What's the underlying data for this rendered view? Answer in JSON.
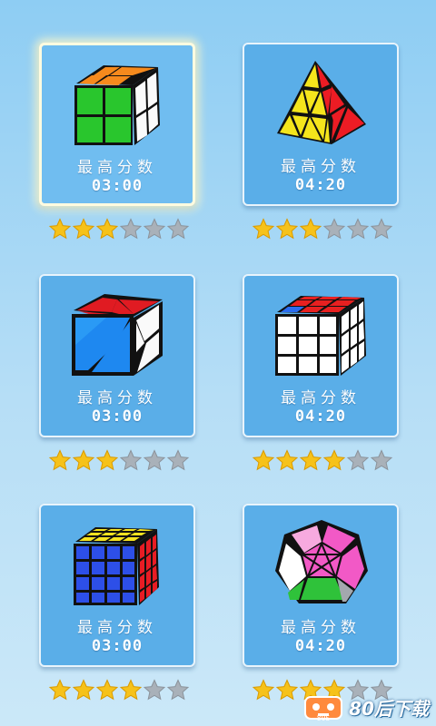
{
  "colors": {
    "card": "#5aaee8",
    "star_filled": "#f6c21a",
    "star_empty": "#a9b1b9"
  },
  "levels": [
    {
      "title": "最高分数",
      "time": "03:00",
      "stars": 3,
      "max_stars": 6,
      "puzzle": "2x2-cube-icon",
      "selected": true
    },
    {
      "title": "最高分数",
      "time": "04:20",
      "stars": 3,
      "max_stars": 6,
      "puzzle": "pyraminx-icon",
      "selected": false
    },
    {
      "title": "最高分数",
      "time": "03:00",
      "stars": 3,
      "max_stars": 6,
      "puzzle": "skewb-icon",
      "selected": false
    },
    {
      "title": "最高分数",
      "time": "04:20",
      "stars": 4,
      "max_stars": 6,
      "puzzle": "3x3-cube-icon",
      "selected": false
    },
    {
      "title": "最高分数",
      "time": "03:00",
      "stars": 4,
      "max_stars": 6,
      "puzzle": "4x4-cube-icon",
      "selected": false
    },
    {
      "title": "最高分数",
      "time": "04:20",
      "stars": 4,
      "max_stars": 6,
      "puzzle": "megaminx-icon",
      "selected": false
    }
  ],
  "watermark": {
    "text": "80后下载",
    "icon": "robot-logo-icon"
  }
}
